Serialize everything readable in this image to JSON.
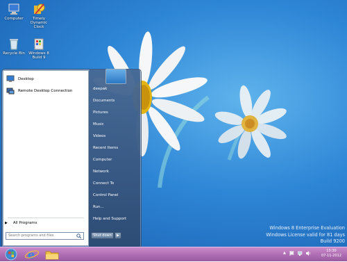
{
  "desktop": {
    "icons": [
      {
        "label": "Computer",
        "icon": "computer-icon"
      },
      {
        "label": "Timely Dynamic Clock",
        "icon": "clock-app-icon"
      },
      {
        "label": "Recycle Bin",
        "icon": "recycle-bin-icon"
      },
      {
        "label": "Windows 8 Build 9",
        "icon": "windows-build-icon"
      }
    ],
    "watermark": {
      "line1": "Windows 8 Enterprise Evaluation",
      "line2": "Windows License valid for 81 days",
      "line3": "Build 9200"
    }
  },
  "start_menu": {
    "pinned": [
      {
        "label": "Desktop",
        "icon": "desktop-icon"
      },
      {
        "label": "Remote Desktop Connection",
        "icon": "remote-desktop-icon"
      }
    ],
    "all_programs": "All Programs",
    "search_placeholder": "Search programs and files",
    "right_items": [
      "deepak",
      "Documents",
      "Pictures",
      "Music",
      "Videos",
      "Recent Items",
      "Computer",
      "Network",
      "Connect To",
      "Control Panel",
      "Run...",
      "Help and Support"
    ],
    "shutdown_label": "Shut down"
  },
  "taskbar": {
    "time": "13:30",
    "date": "07-11-2012",
    "color": "#b06fb4"
  }
}
